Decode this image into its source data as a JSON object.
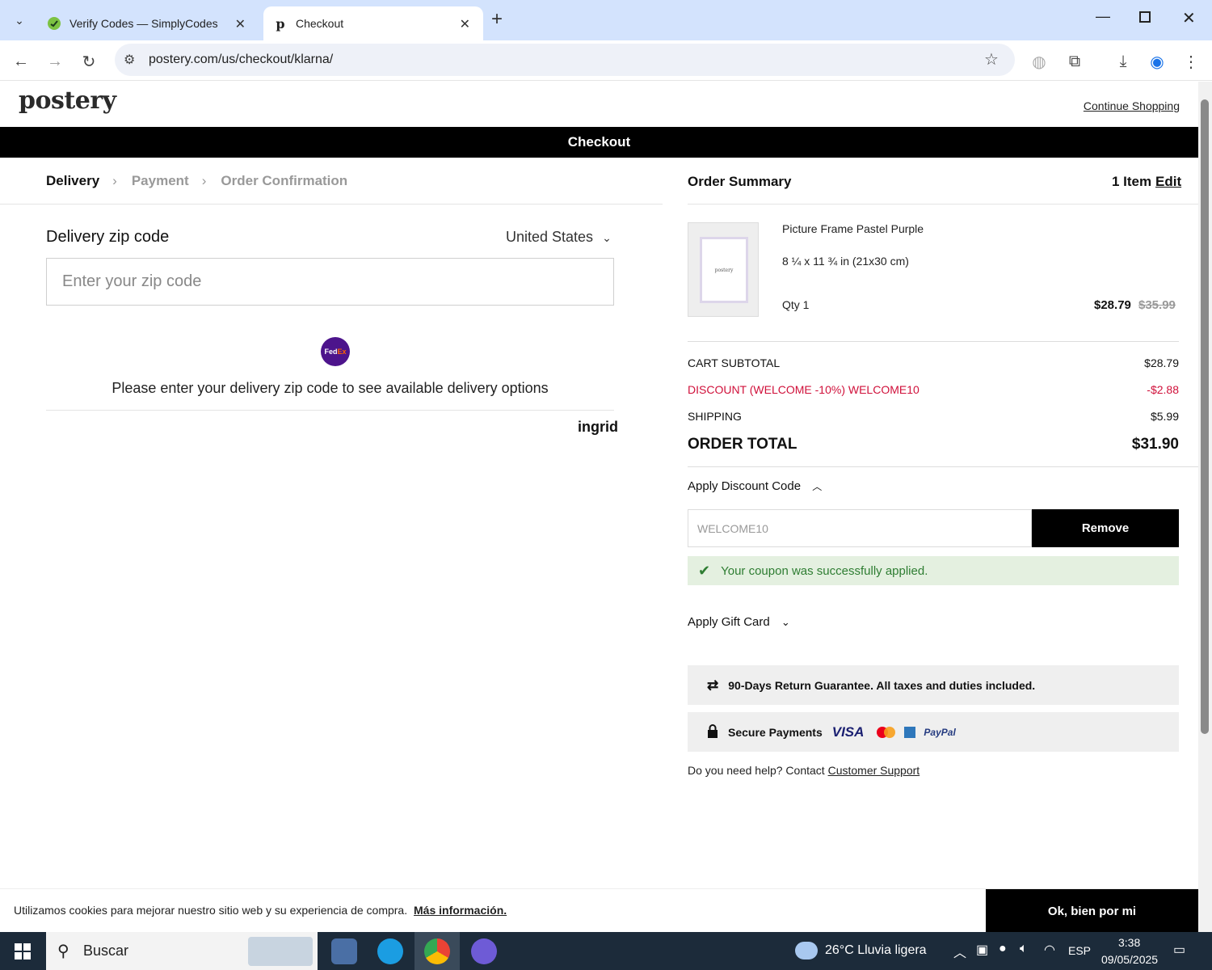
{
  "browser": {
    "tabs": [
      {
        "title": "Verify Codes — SimplyCodes",
        "active": false
      },
      {
        "title": "Checkout",
        "active": true
      }
    ],
    "url": "postery.com/us/checkout/klarna/"
  },
  "header": {
    "logo": "postery",
    "continue_shopping": "Continue Shopping",
    "checkout_label": "Checkout"
  },
  "steps": [
    "Delivery",
    "Payment",
    "Order Confirmation"
  ],
  "delivery": {
    "title": "Delivery zip code",
    "country": "United States",
    "zip_placeholder": "Enter your zip code",
    "carrier_icon": "FedEx",
    "message": "Please enter your delivery zip code to see available delivery options",
    "provider": "ingrid"
  },
  "summary": {
    "title": "Order Summary",
    "item_count": "1 Item",
    "edit_label": "Edit",
    "product": {
      "name": "Picture Frame Pastel Purple",
      "size": "8 ¼ x 11 ¾ in (21x30 cm)",
      "qty": "Qty 1",
      "price": "$28.79",
      "old_price": "$35.99",
      "thumb_text": "postery"
    },
    "rows": {
      "subtotal_label": "CART SUBTOTAL",
      "subtotal_value": "$28.79",
      "discount_label": "DISCOUNT (WELCOME -10%) WELCOME10",
      "discount_value": "-$2.88",
      "shipping_label": "SHIPPING",
      "shipping_value": "$5.99",
      "total_label": "ORDER TOTAL",
      "total_value": "$31.90"
    },
    "discount_toggle": "Apply Discount Code",
    "discount_code": "WELCOME10",
    "remove_label": "Remove",
    "success_message": "Your coupon was successfully applied.",
    "gift_toggle": "Apply Gift Card",
    "guarantee": "90-Days Return Guarantee. All taxes and duties included.",
    "secure_payments": "Secure Payments",
    "payment_brands": [
      "VISA",
      "PayPal"
    ],
    "help_text": "Do you need help? Contact",
    "help_link": "Customer Support"
  },
  "cookie": {
    "text": "Utilizamos cookies para mejorar nuestro sitio web y su experiencia de compra.",
    "link": "Más información.",
    "button": "Ok, bien por mi"
  },
  "taskbar": {
    "search_placeholder": "Buscar",
    "weather": "26°C  Lluvia ligera",
    "language": "ESP",
    "time": "3:38",
    "date": "09/05/2025"
  },
  "colors": {
    "accent_black": "#000000",
    "discount_red": "#d0103a",
    "success_green": "#2e7d32",
    "success_bg": "#e4f0e0",
    "tabbar_bg": "#d3e3fd"
  }
}
